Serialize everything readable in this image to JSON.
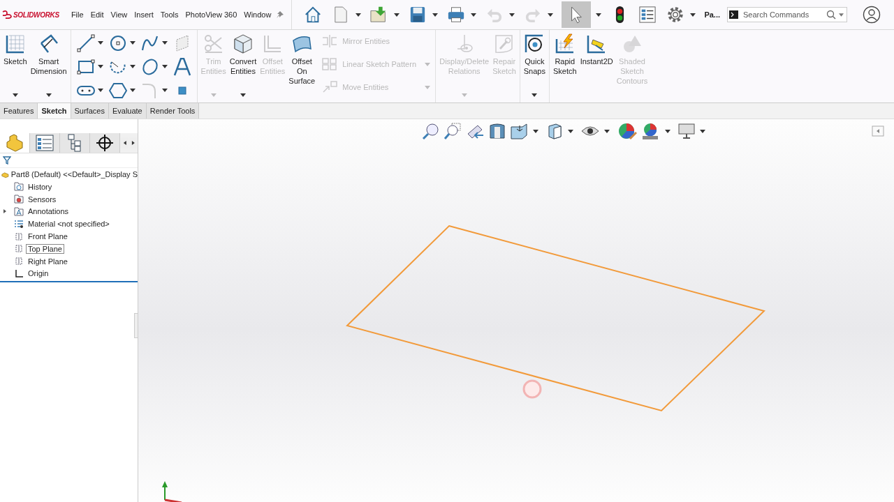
{
  "app": {
    "logo": "SOLIDWORKS"
  },
  "menu": [
    "File",
    "Edit",
    "View",
    "Insert",
    "Tools",
    "PhotoView 360",
    "Window"
  ],
  "quick_access": [
    {
      "kind": "home",
      "selected": false,
      "disabled": false,
      "dropdown": false
    },
    {
      "kind": "new",
      "selected": false,
      "disabled": false,
      "dropdown": true
    },
    {
      "kind": "open",
      "selected": false,
      "disabled": false,
      "dropdown": true
    },
    {
      "kind": "save",
      "selected": false,
      "disabled": false,
      "dropdown": true
    },
    {
      "kind": "print",
      "selected": false,
      "disabled": false,
      "dropdown": true
    },
    {
      "kind": "undo",
      "selected": false,
      "disabled": true,
      "dropdown": true
    },
    {
      "kind": "redo",
      "selected": false,
      "disabled": true,
      "dropdown": true
    },
    {
      "kind": "select",
      "selected": true,
      "disabled": false,
      "dropdown": true
    },
    {
      "kind": "rebuild",
      "selected": false,
      "disabled": false,
      "dropdown": false
    },
    {
      "kind": "file-properties",
      "selected": false,
      "disabled": false,
      "dropdown": false
    },
    {
      "kind": "options",
      "selected": false,
      "disabled": false,
      "dropdown": true
    }
  ],
  "profile_label": "Pa...",
  "search": {
    "placeholder": "Search Commands"
  },
  "ribbon": {
    "sketch_group": [
      {
        "label": "Sketch",
        "disabled": false,
        "dropdown": true
      },
      {
        "label": "Smart\nDimension",
        "disabled": false,
        "dropdown": true
      }
    ],
    "edit_group": [
      {
        "label": "Trim\nEntities",
        "disabled": true,
        "dropdown": true
      },
      {
        "label": "Convert\nEntities",
        "disabled": false,
        "dropdown": true
      },
      {
        "label": "Offset\nEntities",
        "disabled": true,
        "dropdown": false
      },
      {
        "label": "Offset\nOn\nSurface",
        "disabled": false,
        "dropdown": false
      }
    ],
    "pattern_group": [
      {
        "label": "Mirror Entities",
        "disabled": true,
        "dropdown": false
      },
      {
        "label": "Linear Sketch Pattern",
        "disabled": true,
        "dropdown": true
      },
      {
        "label": "Move Entities",
        "disabled": true,
        "dropdown": true
      }
    ],
    "relations_group": [
      {
        "label": "Display/Delete\nRelations",
        "disabled": true,
        "dropdown": true
      },
      {
        "label": "Repair\nSketch",
        "disabled": true,
        "dropdown": false
      }
    ],
    "snaps_group": [
      {
        "label": "Quick\nSnaps",
        "disabled": false,
        "dropdown": true
      }
    ],
    "tools_group": [
      {
        "label": "Rapid\nSketch",
        "disabled": false,
        "dropdown": false
      },
      {
        "label": "Instant2D",
        "disabled": false,
        "dropdown": false
      },
      {
        "label": "Shaded\nSketch\nContours",
        "disabled": true,
        "dropdown": false
      }
    ]
  },
  "tabs": [
    {
      "label": "Features",
      "selected": false
    },
    {
      "label": "Sketch",
      "selected": true
    },
    {
      "label": "Surfaces",
      "selected": false
    },
    {
      "label": "Evaluate",
      "selected": false
    },
    {
      "label": "Render Tools",
      "selected": false
    }
  ],
  "panel_tabs": [
    {
      "selected": true
    },
    {
      "selected": false
    },
    {
      "selected": false
    },
    {
      "selected": false
    }
  ],
  "tree": {
    "label": "Part8 (Default) <<Default>_Display S",
    "children": [
      {
        "label": "History",
        "selected": false,
        "expandable": false
      },
      {
        "label": "Sensors",
        "selected": false,
        "expandable": false
      },
      {
        "label": "Annotations",
        "selected": false,
        "expandable": true,
        "expanded": false
      },
      {
        "label": "Material <not specified>",
        "selected": false,
        "expandable": false
      },
      {
        "label": "Front Plane",
        "selected": false,
        "expandable": false
      },
      {
        "label": "Top Plane",
        "selected": true,
        "expandable": false
      },
      {
        "label": "Right Plane",
        "selected": false,
        "expandable": false
      },
      {
        "label": "Origin",
        "selected": false,
        "expandable": false
      }
    ]
  }
}
